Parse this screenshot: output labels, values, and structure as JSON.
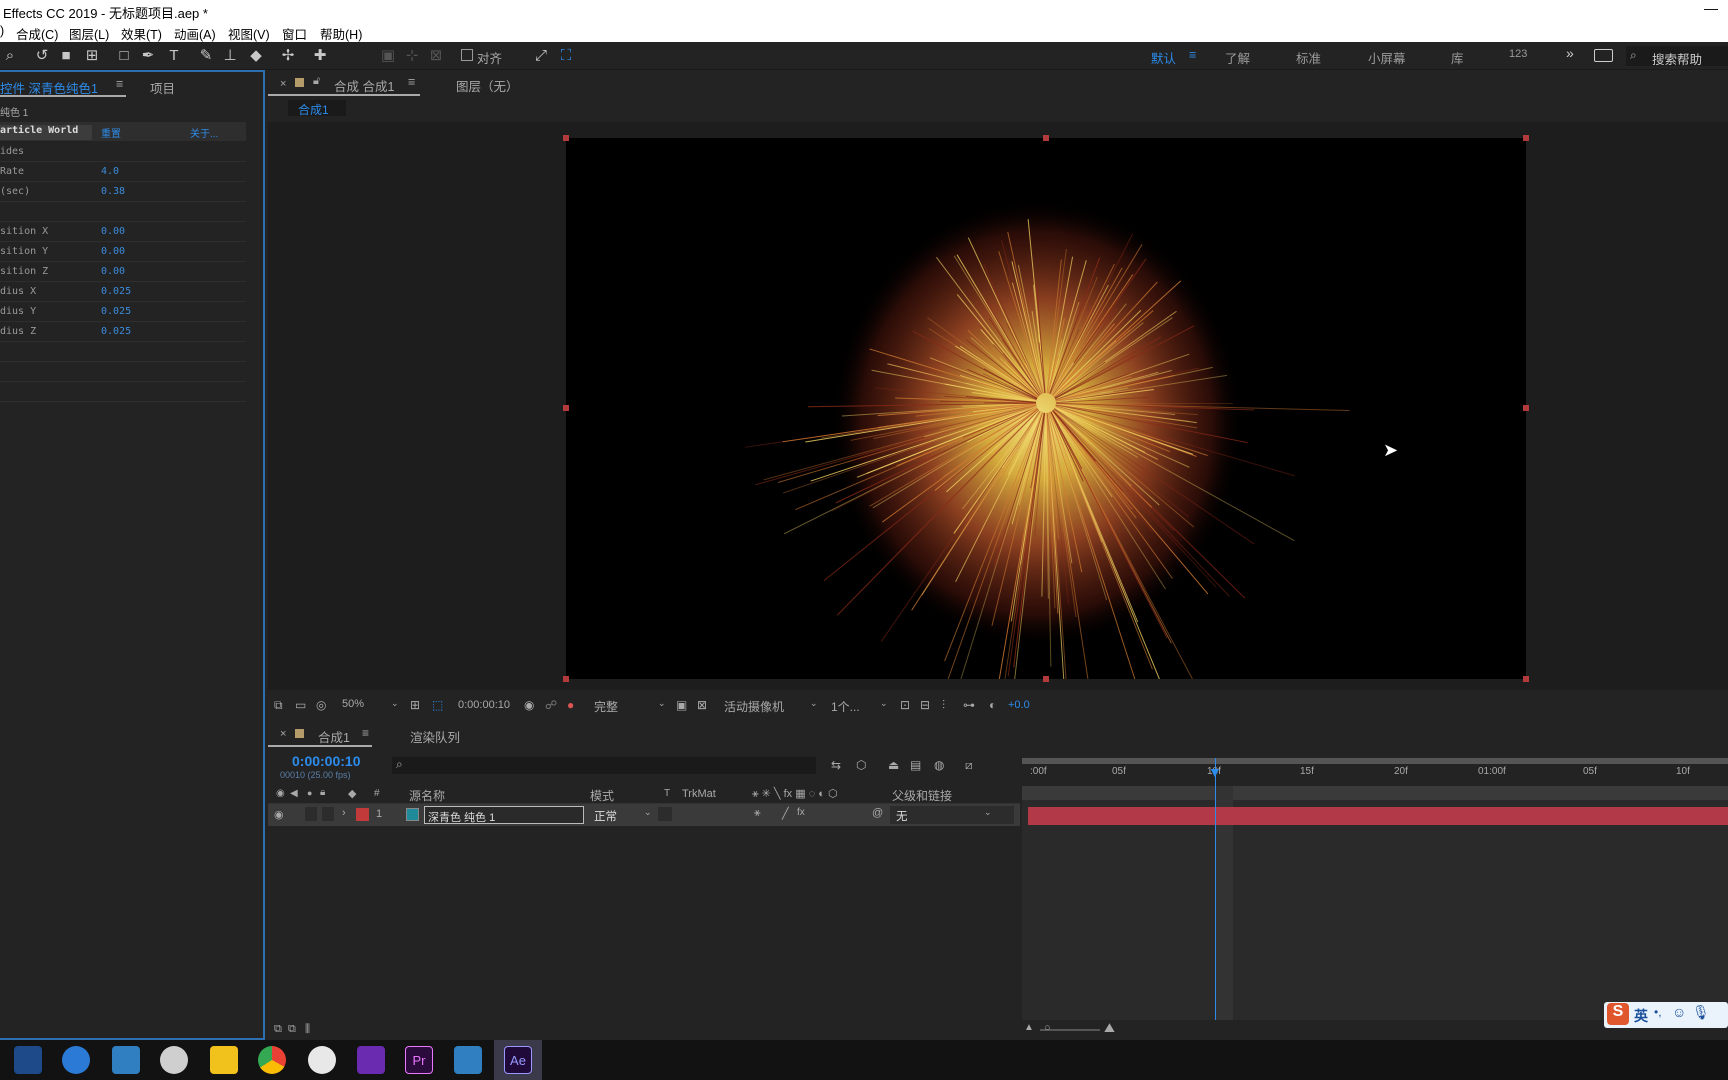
{
  "window": {
    "title": "Effects CC 2019 - 无标题项目.aep *",
    "minimize": "—"
  },
  "menu": [
    "合成(C)",
    "图层(L)",
    "效果(T)",
    "动画(A)",
    "视图(V)",
    "窗口",
    "帮助(H)"
  ],
  "toolbar": {
    "align_label": "对齐"
  },
  "workspaces": [
    "默认",
    "了解",
    "标准",
    "小屏幕",
    "库",
    "123"
  ],
  "search_help": "搜索帮助",
  "effect_panel": {
    "tab_label": "控件 深青色纯色1",
    "project_tab": "项目",
    "layer_name": "纯色 1",
    "effect_name": "article World",
    "reset_label": "重置",
    "about_label": "关于...",
    "rows": [
      {
        "label": "ides",
        "value": ""
      },
      {
        "label": "Rate",
        "value": "4.0"
      },
      {
        "label": "(sec)",
        "value": "0.38"
      },
      {
        "label": "",
        "value": ""
      },
      {
        "label": "sition X",
        "value": "0.00"
      },
      {
        "label": "sition Y",
        "value": "0.00"
      },
      {
        "label": "sition Z",
        "value": "0.00"
      },
      {
        "label": "dius X",
        "value": "0.025"
      },
      {
        "label": "dius Y",
        "value": "0.025"
      },
      {
        "label": "dius Z",
        "value": "0.025"
      },
      {
        "label": "",
        "value": ""
      },
      {
        "label": "",
        "value": ""
      },
      {
        "label": "",
        "value": ""
      }
    ]
  },
  "comp_panel": {
    "tab_label": "合成 合成1",
    "layer_tab": "图层（无）",
    "breadcrumb": "合成1"
  },
  "viewer_bar": {
    "zoom": "50%",
    "timecode": "0:00:00:10",
    "resolution": "完整",
    "camera": "活动摄像机",
    "views": "1个...",
    "exposure": "+0.0"
  },
  "timeline": {
    "tab_label": "合成1",
    "render_tab": "渲染队列",
    "timecode": "0:00:00:10",
    "frame_info": "00010 (25.00 fps)",
    "columns": {
      "number": "#",
      "source_name": "源名称",
      "mode": "模式",
      "t": "T",
      "trkmat": "TrkMat",
      "parent": "父级和链接"
    },
    "layer": {
      "number": "1",
      "name": "深青色 纯色 1",
      "mode": "正常",
      "parent": "无"
    },
    "ruler_ticks": [
      ":00f",
      "05f",
      "10f",
      "15f",
      "20f",
      "01:00f",
      "05f",
      "10f"
    ]
  },
  "ime": {
    "label": "英"
  },
  "colors": {
    "accent": "#2d8ceb",
    "layer_bar": "#b23a48",
    "label_red": "#c23a3a",
    "layer_color": "#1f8a9a"
  }
}
